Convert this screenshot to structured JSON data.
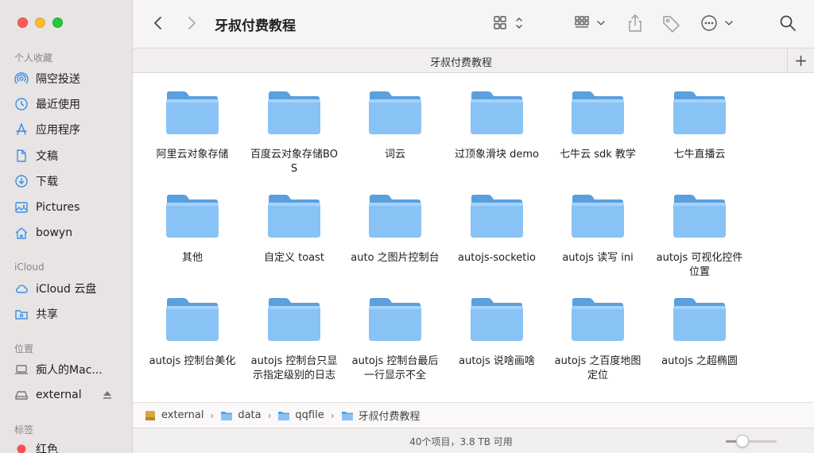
{
  "window": {
    "title": "牙叔付费教程"
  },
  "sidebar": {
    "sections": [
      {
        "title": "个人收藏",
        "items": [
          {
            "label": "隔空投送",
            "icon": "airdrop-icon"
          },
          {
            "label": "最近使用",
            "icon": "clock-icon"
          },
          {
            "label": "应用程序",
            "icon": "applications-icon"
          },
          {
            "label": "文稿",
            "icon": "document-icon"
          },
          {
            "label": "下载",
            "icon": "download-icon"
          },
          {
            "label": "Pictures",
            "icon": "pictures-icon"
          },
          {
            "label": "bowyn",
            "icon": "home-icon"
          }
        ]
      },
      {
        "title": "iCloud",
        "items": [
          {
            "label": "iCloud 云盘",
            "icon": "icloud-icon"
          },
          {
            "label": "共享",
            "icon": "shared-folder-icon"
          }
        ]
      },
      {
        "title": "位置",
        "items": [
          {
            "label": "痴人的Mac...",
            "icon": "laptop-icon"
          },
          {
            "label": "external",
            "icon": "drive-icon"
          }
        ]
      },
      {
        "title": "标签",
        "items": [
          {
            "label": "红色",
            "icon": "red-tag-icon"
          }
        ]
      }
    ]
  },
  "tab": {
    "title": "牙叔付费教程",
    "add": "+"
  },
  "folders": [
    {
      "name": "阿里云对象存储"
    },
    {
      "name": "百度云对象存储BOS"
    },
    {
      "name": "词云"
    },
    {
      "name": "过顶象滑块 demo"
    },
    {
      "name": "七牛云 sdk 教学"
    },
    {
      "name": "七牛直播云"
    },
    {
      "name": "其他"
    },
    {
      "name": "自定义 toast"
    },
    {
      "name": "auto 之图片控制台"
    },
    {
      "name": "autojs-socketio"
    },
    {
      "name": "autojs 读写 ini"
    },
    {
      "name": "autojs 可视化控件位置"
    },
    {
      "name": "autojs 控制台美化"
    },
    {
      "name": "autojs 控制台只显示指定级别的日志"
    },
    {
      "name": "autojs 控制台最后一行显示不全"
    },
    {
      "name": "autojs 说啥画啥"
    },
    {
      "name": "autojs 之百度地图定位"
    },
    {
      "name": "autojs 之超椭圆"
    }
  ],
  "pathbar": {
    "crumbs": [
      {
        "label": "external",
        "icon": "drive-icon"
      },
      {
        "label": "data",
        "icon": "folder-icon"
      },
      {
        "label": "qqfile",
        "icon": "folder-icon"
      },
      {
        "label": "牙叔付费教程",
        "icon": "folder-icon"
      }
    ],
    "separator": "›"
  },
  "status": {
    "text": "40个项目，3.8 TB 可用",
    "zoom_fraction": 0.33
  },
  "colors": {
    "folder_front": "#89c3f5",
    "folder_back": "#5aa0df",
    "accent": "#3a8ee6"
  }
}
